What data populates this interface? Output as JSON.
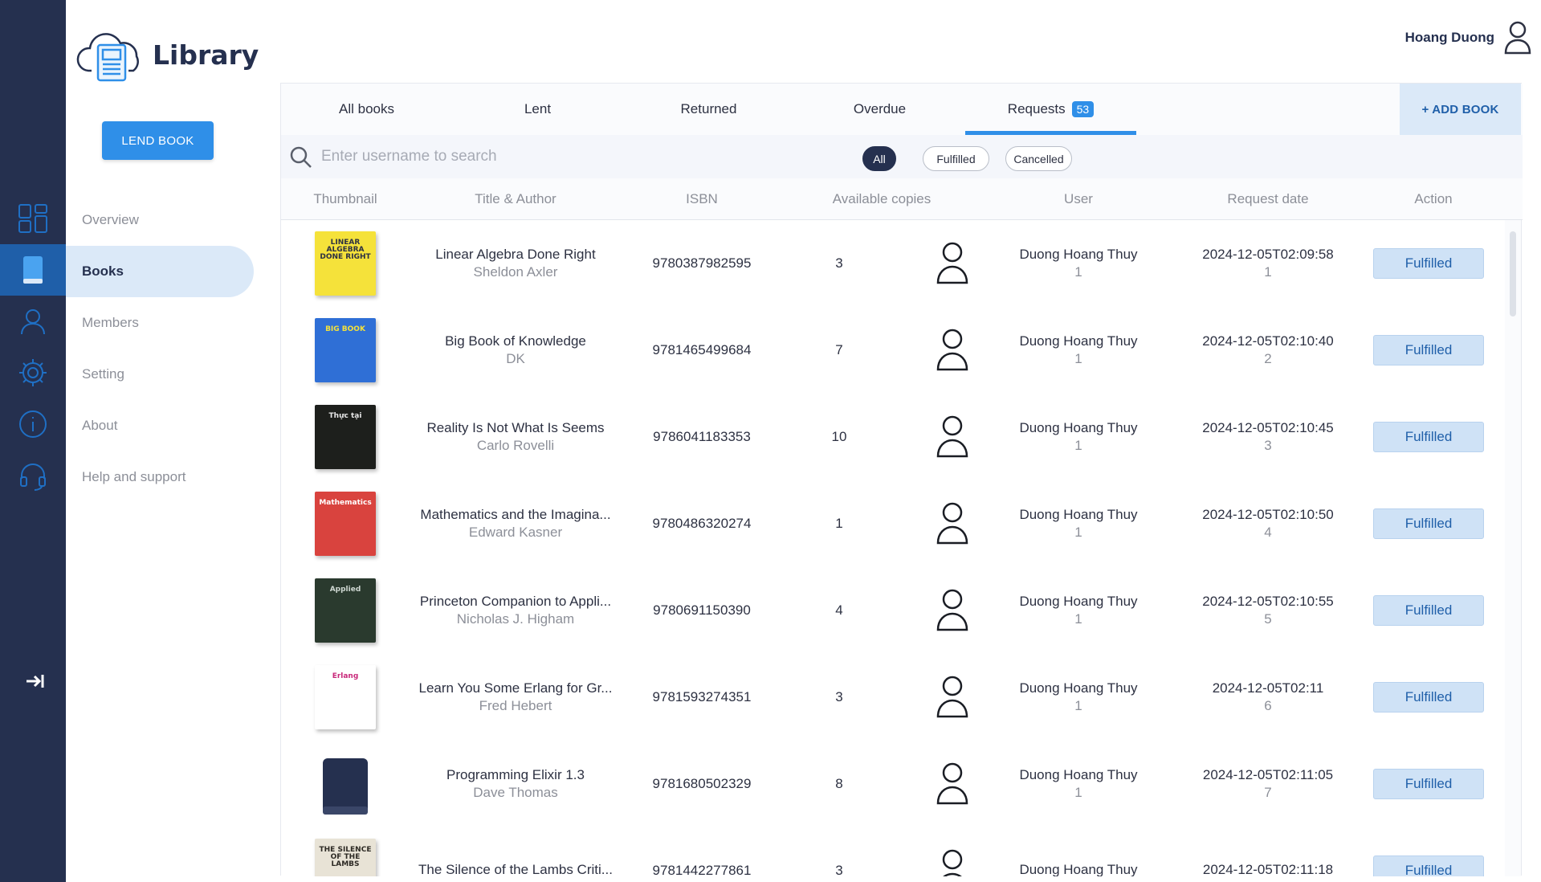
{
  "app": {
    "title": "Library"
  },
  "sidebar": {
    "lend_button": "LEND BOOK",
    "items": [
      {
        "label": "Overview",
        "icon": "dashboard-icon"
      },
      {
        "label": "Books",
        "icon": "book-icon",
        "active": true
      },
      {
        "label": "Members",
        "icon": "members-icon"
      },
      {
        "label": "Setting",
        "icon": "gear-icon"
      },
      {
        "label": "About",
        "icon": "info-icon"
      },
      {
        "label": "Help and support",
        "icon": "headset-icon"
      }
    ],
    "logout_icon": "logout-icon"
  },
  "header": {
    "user_name": "Hoang Duong"
  },
  "tabs": [
    {
      "label": "All books"
    },
    {
      "label": "Lent"
    },
    {
      "label": "Returned"
    },
    {
      "label": "Overdue"
    },
    {
      "label": "Requests",
      "badge": "53",
      "active": true
    }
  ],
  "add_book_label": "+ ADD BOOK",
  "search": {
    "placeholder": "Enter username to search",
    "value": ""
  },
  "filters": [
    {
      "label": "All",
      "active": true
    },
    {
      "label": "Fulfilled"
    },
    {
      "label": "Cancelled"
    }
  ],
  "columns": [
    "Thumbnail",
    "Title & Author",
    "ISBN",
    "Available copies",
    "User",
    "Request date",
    "Action"
  ],
  "rows": [
    {
      "title": "Linear Algebra Done Right",
      "author": "Sheldon Axler",
      "isbn": "9780387982595",
      "copies": "3",
      "user": "Duong Hoang Thuy",
      "user_id": "1",
      "date": "2024-12-05T02:09:58",
      "req_id": "1",
      "action": "Fulfilled",
      "cover": {
        "bg": "#f5e23a",
        "fg": "#2d3142",
        "text": "LINEAR ALGEBRA DONE RIGHT"
      }
    },
    {
      "title": "Big Book of Knowledge",
      "author": "DK",
      "isbn": "9781465499684",
      "copies": "7",
      "user": "Duong Hoang Thuy",
      "user_id": "1",
      "date": "2024-12-05T02:10:40",
      "req_id": "2",
      "action": "Fulfilled",
      "cover": {
        "bg": "#2f6fd6",
        "fg": "#f5e23a",
        "text": "BIG BOOK"
      }
    },
    {
      "title": "Reality Is Not What Is Seems",
      "author": "Carlo Rovelli",
      "isbn": "9786041183353",
      "copies": "10",
      "user": "Duong Hoang Thuy",
      "user_id": "1",
      "date": "2024-12-05T02:10:45",
      "req_id": "3",
      "action": "Fulfilled",
      "cover": {
        "bg": "#1d1f1c",
        "fg": "#e8e8e8",
        "text": "Thực tại"
      }
    },
    {
      "title": "Mathematics and the Imagina...",
      "author": "Edward Kasner",
      "isbn": "9780486320274",
      "copies": "1",
      "user": "Duong Hoang Thuy",
      "user_id": "1",
      "date": "2024-12-05T02:10:50",
      "req_id": "4",
      "action": "Fulfilled",
      "cover": {
        "bg": "#d9433e",
        "fg": "#ffffff",
        "text": "Mathematics"
      }
    },
    {
      "title": "Princeton Companion to Appli...",
      "author": "Nicholas J. Higham",
      "isbn": "9780691150390",
      "copies": "4",
      "user": "Duong Hoang Thuy",
      "user_id": "1",
      "date": "2024-12-05T02:10:55",
      "req_id": "5",
      "action": "Fulfilled",
      "cover": {
        "bg": "#2a3a2e",
        "fg": "#cfd8d2",
        "text": "Applied"
      }
    },
    {
      "title": "Learn You Some Erlang for Gr...",
      "author": "Fred Hebert",
      "isbn": "9781593274351",
      "copies": "3",
      "user": "Duong Hoang Thuy",
      "user_id": "1",
      "date": "2024-12-05T02:11",
      "req_id": "6",
      "action": "Fulfilled",
      "cover": {
        "bg": "#ffffff",
        "fg": "#c8287a",
        "text": "Erlang"
      }
    },
    {
      "title": "Programming Elixir 1.3",
      "author": "Dave Thomas",
      "isbn": "9781680502329",
      "copies": "8",
      "user": "Duong Hoang Thuy",
      "user_id": "1",
      "date": "2024-12-05T02:11:05",
      "req_id": "7",
      "action": "Fulfilled",
      "cover": {
        "bg": "placeholder",
        "fg": "#25304f",
        "text": ""
      }
    },
    {
      "title": "The Silence of the Lambs Criti...",
      "author": "",
      "isbn": "9781442277861",
      "copies": "3",
      "user": "Duong Hoang Thuy",
      "user_id": "",
      "date": "2024-12-05T02:11:18",
      "req_id": "",
      "action": "Fulfilled",
      "cover": {
        "bg": "#e8e3d6",
        "fg": "#2d2a24",
        "text": "THE SILENCE OF THE LAMBS"
      }
    }
  ],
  "colors": {
    "rail": "#25304f",
    "accent": "#2f8fe8",
    "active_bg": "#dbe9f8"
  }
}
